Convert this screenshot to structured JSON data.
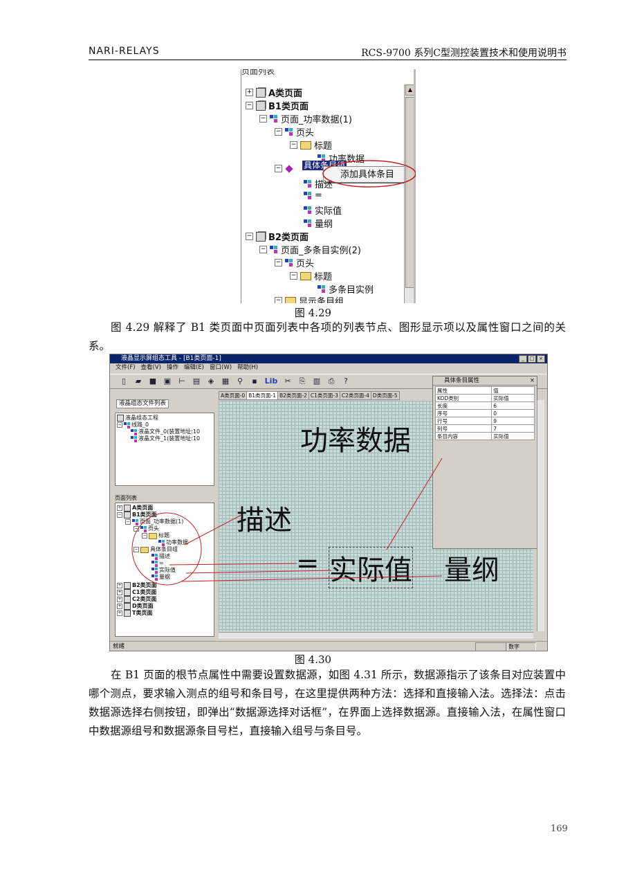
{
  "header": {
    "left": "NARI-RELAYS",
    "right": "RCS-9700 系列C型测控装置技术和使用说明书"
  },
  "fig29": {
    "panel_title": "页面列表",
    "caption": "图 4.29",
    "context_menu": "添加具体条目",
    "selected_item": "具体条目组",
    "tree": [
      {
        "label": "A类页面",
        "bold": true
      },
      {
        "label": "B1类页面",
        "bold": true
      },
      {
        "label": "页面_功率数据(1)"
      },
      {
        "label": "页头"
      },
      {
        "label": "标题"
      },
      {
        "label": "功率数据"
      },
      {
        "label": "描述"
      },
      {
        "label": "="
      },
      {
        "label": "实际值"
      },
      {
        "label": "量纲"
      },
      {
        "label": "B2类页面",
        "bold": true
      },
      {
        "label": "页面_多条目实例(2)"
      },
      {
        "label": "页头"
      },
      {
        "label": "标题"
      },
      {
        "label": "多条目实例"
      },
      {
        "label": "显示条目组"
      }
    ]
  },
  "paragraph1": "图 4.29 解释了 B1 类页面中页面列表中各项的列表节点、图形显示项以及属性窗口之间的关系。",
  "fig30": {
    "caption": "图 4.30",
    "window_title": "液晶显示屏组态工具 - [B1类页面-1]",
    "menu": [
      "文件(F)",
      "查看(V)",
      "操作",
      "编辑(E)",
      "窗口(W)",
      "帮助(H)"
    ],
    "toolbar_lib": "Lib",
    "file_tab": "液晶组态文件列表",
    "file_tree": [
      "液晶组态工程",
      "线路_0",
      "液晶文件_0(装置地址:10",
      "液晶文件_1(装置地址:10"
    ],
    "page_list_label": "页面列表",
    "page_tree": [
      "A类页面",
      "B1类页面",
      "页面_功率数据(1)",
      "页头",
      "标题",
      "功率数据",
      "具体条目组",
      "描述",
      "=",
      "实际值",
      "量纲",
      "B2类页面",
      "C1类页面",
      "C2类页面",
      "D类页面",
      "T类页面"
    ],
    "tabs": [
      "A类页面-0",
      "B1类页面-1",
      "B2类页面-2",
      "C1类页面-3",
      "C2类页面-4",
      "D类页面-5"
    ],
    "canvas_text": {
      "title": "功率数据",
      "desc": "描述",
      "eq": "=",
      "value": "实际值",
      "unit": "量纲"
    },
    "props": {
      "title": "具体条目属性",
      "header": [
        "属性",
        "值"
      ],
      "rows": [
        [
          "属性",
          "值"
        ],
        [
          "KOD类别",
          "实际值"
        ],
        [
          "长度",
          "6"
        ],
        [
          "序号",
          "0"
        ],
        [
          "行号",
          "9"
        ],
        [
          "列号",
          "7"
        ],
        [
          "条目内容",
          "实际值"
        ]
      ]
    },
    "status": "就绪",
    "status_num": "数字"
  },
  "paragraph2": "在 B1 页面的根节点属性中需要设置数据源，如图 4.31 所示，数据源指示了该条目对应装置中哪个测点，要求输入测点的组号和条目号，在这里提供两种方法：选择和直接输入法。选择法：点击数据源选择右侧按钮，即弹出“数据源选择对话框”，在界面上选择数据源。直接输入法，在属性窗口中数据源组号和数据源条目号栏，直接输入组号与条目号。",
  "page_number": "169"
}
